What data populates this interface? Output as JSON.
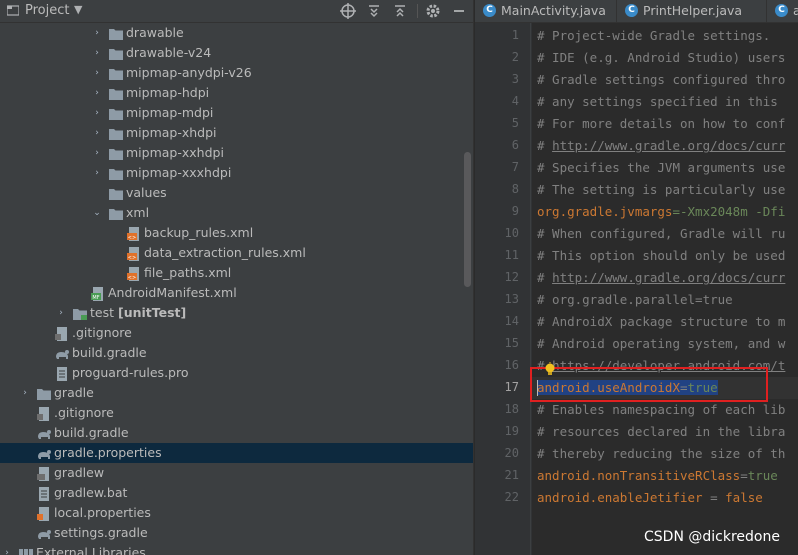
{
  "project": {
    "title": "Project",
    "dropdown_glyph": "▼",
    "toolbar_icons": [
      "target-icon",
      "expand-all-icon",
      "collapse-all-icon",
      "gear-icon",
      "minimize-icon"
    ]
  },
  "tree": [
    {
      "label": "drawable",
      "arrow": "›",
      "icon": "folder"
    },
    {
      "label": "drawable-v24",
      "arrow": "›",
      "icon": "folder"
    },
    {
      "label": "mipmap-anydpi-v26",
      "arrow": "›",
      "icon": "folder"
    },
    {
      "label": "mipmap-hdpi",
      "arrow": "›",
      "icon": "folder"
    },
    {
      "label": "mipmap-mdpi",
      "arrow": "›",
      "icon": "folder"
    },
    {
      "label": "mipmap-xhdpi",
      "arrow": "›",
      "icon": "folder"
    },
    {
      "label": "mipmap-xxhdpi",
      "arrow": "›",
      "icon": "folder"
    },
    {
      "label": "mipmap-xxxhdpi",
      "arrow": "›",
      "icon": "folder"
    },
    {
      "label": "values",
      "arrow": "",
      "icon": "folder"
    },
    {
      "label": "xml",
      "arrow": "⌄",
      "icon": "folder"
    },
    {
      "label": "backup_rules.xml",
      "arrow": "",
      "icon": "xml"
    },
    {
      "label": "data_extraction_rules.xml",
      "arrow": "",
      "icon": "xml"
    },
    {
      "label": "file_paths.xml",
      "arrow": "",
      "icon": "xml"
    },
    {
      "label": "AndroidManifest.xml",
      "arrow": "",
      "icon": "manifest"
    },
    {
      "label": "test",
      "bold": "[unitTest]",
      "arrow": "›",
      "icon": "folder-test"
    },
    {
      "label": ".gitignore",
      "arrow": "",
      "icon": "gitignore"
    },
    {
      "label": "build.gradle",
      "arrow": "",
      "icon": "gradle"
    },
    {
      "label": "proguard-rules.pro",
      "arrow": "",
      "icon": "file"
    },
    {
      "label": "gradle",
      "arrow": "›",
      "icon": "folder"
    },
    {
      "label": ".gitignore",
      "arrow": "",
      "icon": "gitignore"
    },
    {
      "label": "build.gradle",
      "arrow": "",
      "icon": "gradle"
    },
    {
      "label": "gradle.properties",
      "arrow": "",
      "icon": "gradle"
    },
    {
      "label": "gradlew",
      "arrow": "",
      "icon": "script"
    },
    {
      "label": "gradlew.bat",
      "arrow": "",
      "icon": "file"
    },
    {
      "label": "local.properties",
      "arrow": "",
      "icon": "properties"
    },
    {
      "label": "settings.gradle",
      "arrow": "",
      "icon": "gradle"
    },
    {
      "label": "External Libraries",
      "arrow": "›",
      "icon": "library"
    }
  ],
  "tabs": [
    {
      "label": "MainActivity.java",
      "icon_letter": "C"
    },
    {
      "label": "PrintHelper.java",
      "icon_letter": "C"
    },
    {
      "label": "ap",
      "icon_letter": "C"
    }
  ],
  "editor": {
    "line_numbers": [
      "1",
      "2",
      "3",
      "4",
      "5",
      "6",
      "7",
      "8",
      "9",
      "10",
      "11",
      "12",
      "13",
      "14",
      "15",
      "16",
      "17",
      "18",
      "19",
      "20",
      "21",
      "22"
    ],
    "current_line": "17",
    "lines": [
      [
        {
          "t": "# Project-wide Gradle settings.",
          "c": "com"
        }
      ],
      [
        {
          "t": "# IDE (e.g. Android Studio) users",
          "c": "com"
        }
      ],
      [
        {
          "t": "# Gradle settings configured thro",
          "c": "com"
        }
      ],
      [
        {
          "t": "# any settings specified in this ",
          "c": "com"
        }
      ],
      [
        {
          "t": "# For more details on how to conf",
          "c": "com"
        }
      ],
      [
        {
          "t": "# ",
          "c": "com"
        },
        {
          "t": "http://www.gradle.org/docs/curr",
          "c": "link"
        }
      ],
      [
        {
          "t": "# Specifies the JVM arguments use",
          "c": "com"
        }
      ],
      [
        {
          "t": "# The setting is particularly use",
          "c": "com"
        }
      ],
      [
        {
          "t": "org.gradle.jvmargs",
          "c": "key"
        },
        {
          "t": "=-Xmx2048m -Dfi",
          "c": "val"
        }
      ],
      [
        {
          "t": "# When configured, Gradle will ru",
          "c": "com"
        }
      ],
      [
        {
          "t": "# This option should only be used",
          "c": "com"
        }
      ],
      [
        {
          "t": "# ",
          "c": "com"
        },
        {
          "t": "http://www.gradle.org/docs/curr",
          "c": "link"
        }
      ],
      [
        {
          "t": "# org.gradle.parallel=true",
          "c": "com"
        }
      ],
      [
        {
          "t": "# AndroidX package structure to m",
          "c": "com"
        }
      ],
      [
        {
          "t": "# Android operating system, and w",
          "c": "com"
        }
      ],
      [
        {
          "t": "# ",
          "c": "com"
        },
        {
          "t": "https://developer.android.com/t",
          "c": "link"
        }
      ],
      [
        {
          "t": "android.useAndroidX",
          "c": "key",
          "sel": true
        },
        {
          "t": "=",
          "c": "com",
          "sel": true
        },
        {
          "t": "true",
          "c": "val",
          "sel": true
        }
      ],
      [
        {
          "t": "# Enables namespacing of each lib",
          "c": "com"
        }
      ],
      [
        {
          "t": "# resources declared in the libra",
          "c": "com"
        }
      ],
      [
        {
          "t": "# thereby reducing the size of th",
          "c": "com"
        }
      ],
      [
        {
          "t": "android.nonTransitiveRClass",
          "c": "key"
        },
        {
          "t": "=",
          "c": "com"
        },
        {
          "t": "true",
          "c": "val"
        }
      ],
      [
        {
          "t": "android.enableJetifier",
          "c": "key"
        },
        {
          "t": " = ",
          "c": "com"
        },
        {
          "t": "false",
          "c": "kw"
        }
      ]
    ]
  },
  "watermark": "CSDN @dickredone",
  "colors": {
    "selection_row": "#0d293e",
    "highlight_box": "#e02020",
    "selected_text": "#214283"
  }
}
